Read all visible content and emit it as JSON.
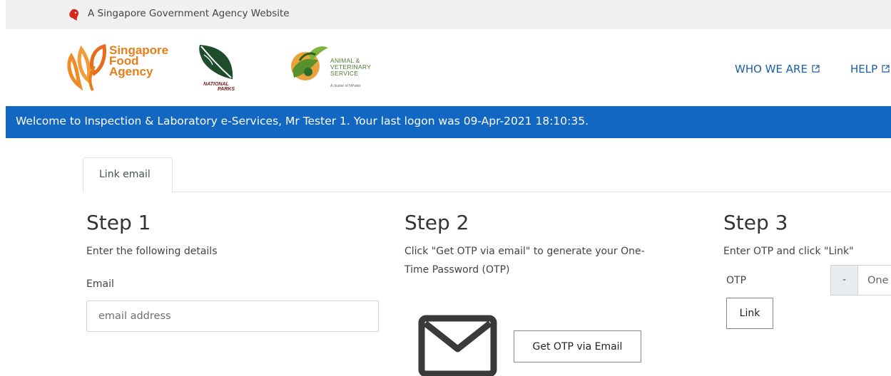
{
  "gov_banner": {
    "text": "A Singapore Government Agency Website"
  },
  "logos": {
    "sfa": {
      "lines": [
        "Singapore",
        "Food",
        "Agency"
      ]
    },
    "nparks": {
      "lines": [
        "NATIONAL",
        "PARKS"
      ]
    },
    "avs": {
      "lines": [
        "ANIMAL &",
        "VETERINARY",
        "SERVICE"
      ],
      "tagline": "A cluster of NParks"
    }
  },
  "nav": {
    "who_we_are": "WHO WE ARE",
    "help": "HELP"
  },
  "welcome": {
    "text": "Welcome to Inspection & Laboratory e-Services, Mr Tester 1. Your last logon was 09-Apr-2021 18:10:35."
  },
  "tabs": [
    {
      "label": "Link email"
    }
  ],
  "step1": {
    "title": "Step 1",
    "description": "Enter the following details",
    "email_label": "Email",
    "email_placeholder": "email address",
    "email_value": ""
  },
  "step2": {
    "title": "Step 2",
    "description_line1": "Click \"Get OTP via email\" to generate your One-",
    "description_line2": "Time Password (OTP)",
    "icon": "envelope-icon",
    "button_label": "Get OTP via Email"
  },
  "step3": {
    "title": "Step 3",
    "description": "Enter OTP and click \"Link\"",
    "otp_label": "OTP",
    "otp_prefix": "-",
    "otp_placeholder": "One",
    "link_button": "Link"
  },
  "colors": {
    "brand_blue": "#1267c2",
    "link_blue": "#1a5ea8",
    "sfa_orange": "#e87e1a",
    "gov_red": "#d9261c"
  }
}
